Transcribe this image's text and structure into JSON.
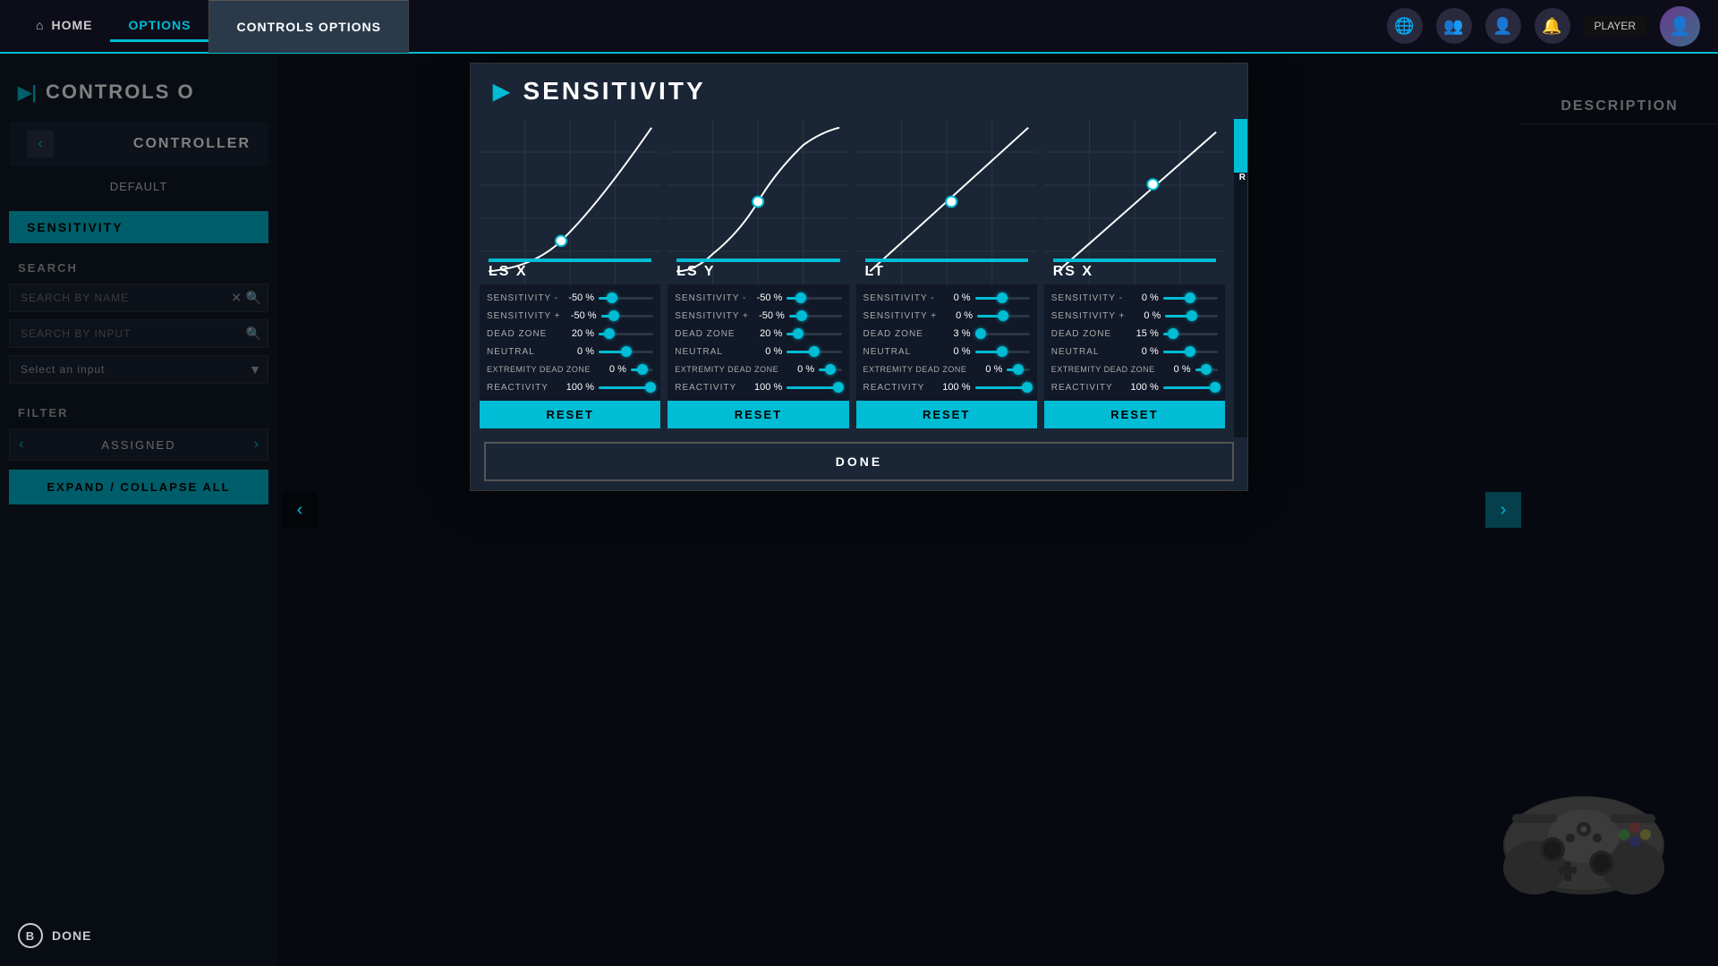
{
  "topbar": {
    "home_label": "HOME",
    "options_label": "OPTIONS",
    "controls_options_label": "CONTROLS OPTIONS",
    "username": "PLAYER",
    "icons": [
      "🌐",
      "👥",
      "👤",
      "🔔"
    ]
  },
  "sidebar": {
    "title": "CONTROLS O",
    "arrow": "▶|",
    "controller": {
      "label": "CONTROLLER",
      "default": "DEFAULT",
      "nav_left": "‹",
      "nav_right": "›"
    },
    "active_tab": "SENSITIVITY",
    "search": {
      "label": "SEARCH",
      "by_name_placeholder": "SEARCH BY NAME",
      "by_input_placeholder": "SEARCH BY INPUT",
      "select_input": "Select an input"
    },
    "filter": {
      "label": "FILTER",
      "value": "ASSIGNED",
      "nav_left": "‹",
      "nav_right": "›"
    },
    "expand_collapse": "EXPAND / COLLAPSE ALL"
  },
  "sensitivity_modal": {
    "title": "SENSITIVITY",
    "arrow": "▶",
    "columns": [
      {
        "id": "ls_x",
        "label": "LS X",
        "curve_type": "exponential",
        "sensitivity_minus": {
          "label": "SENSITIVITY -",
          "value": "-50 %",
          "fill": 25
        },
        "sensitivity_plus": {
          "label": "SENSITIVITY +",
          "value": "-50 %",
          "fill": 25
        },
        "dead_zone": {
          "label": "DEAD ZONE",
          "value": "20 %",
          "fill": 20
        },
        "neutral": {
          "label": "NEUTRAL",
          "value": "0 %",
          "fill": 50
        },
        "extremity_dead_zone": {
          "label": "EXTREMITY DEAD ZONE",
          "value": "0 %",
          "fill": 50
        },
        "reactivity": {
          "label": "REACTIVITY",
          "value": "100 %",
          "fill": 95
        },
        "reset_label": "RESET"
      },
      {
        "id": "ls_y",
        "label": "LS Y",
        "curve_type": "s-curve",
        "sensitivity_minus": {
          "label": "SENSITIVITY -",
          "value": "-50 %",
          "fill": 25
        },
        "sensitivity_plus": {
          "label": "SENSITIVITY +",
          "value": "-50 %",
          "fill": 25
        },
        "dead_zone": {
          "label": "DEAD ZONE",
          "value": "20 %",
          "fill": 20
        },
        "neutral": {
          "label": "NEUTRAL",
          "value": "0 %",
          "fill": 50
        },
        "extremity_dead_zone": {
          "label": "EXTREMITY DEAD ZONE",
          "value": "0 %",
          "fill": 50
        },
        "reactivity": {
          "label": "REACTIVITY",
          "value": "100 %",
          "fill": 95
        },
        "reset_label": "RESET"
      },
      {
        "id": "lt",
        "label": "LT",
        "curve_type": "linear",
        "sensitivity_minus": {
          "label": "SENSITIVITY -",
          "value": "0 %",
          "fill": 50
        },
        "sensitivity_plus": {
          "label": "SENSITIVITY +",
          "value": "0 %",
          "fill": 50
        },
        "dead_zone": {
          "label": "DEAD ZONE",
          "value": "3 %",
          "fill": 15
        },
        "neutral": {
          "label": "NEUTRAL",
          "value": "0 %",
          "fill": 50
        },
        "extremity_dead_zone": {
          "label": "EXTREMITY DEAD ZONE",
          "value": "0 %",
          "fill": 50
        },
        "reactivity": {
          "label": "REACTIVITY",
          "value": "100 %",
          "fill": 95
        },
        "reset_label": "RESET"
      },
      {
        "id": "rs_x",
        "label": "RS X",
        "curve_type": "linear-gentle",
        "sensitivity_minus": {
          "label": "SENSITIVITY -",
          "value": "0 %",
          "fill": 50
        },
        "sensitivity_plus": {
          "label": "SENSITIVITY +",
          "value": "0 %",
          "fill": 50
        },
        "dead_zone": {
          "label": "DEAD ZONE",
          "value": "15 %",
          "fill": 20
        },
        "neutral": {
          "label": "NEUTRAL",
          "value": "0 %",
          "fill": 50
        },
        "extremity_dead_zone": {
          "label": "EXTREMITY DEAD ZONE",
          "value": "0 %",
          "fill": 50
        },
        "reactivity": {
          "label": "REACTIVITY",
          "value": "100 %",
          "fill": 95
        },
        "reset_label": "RESET"
      }
    ],
    "done_label": "DONE"
  },
  "description": {
    "title": "DESCRIPTION"
  },
  "bottom": {
    "done_label": "DONE",
    "b_button": "B"
  }
}
